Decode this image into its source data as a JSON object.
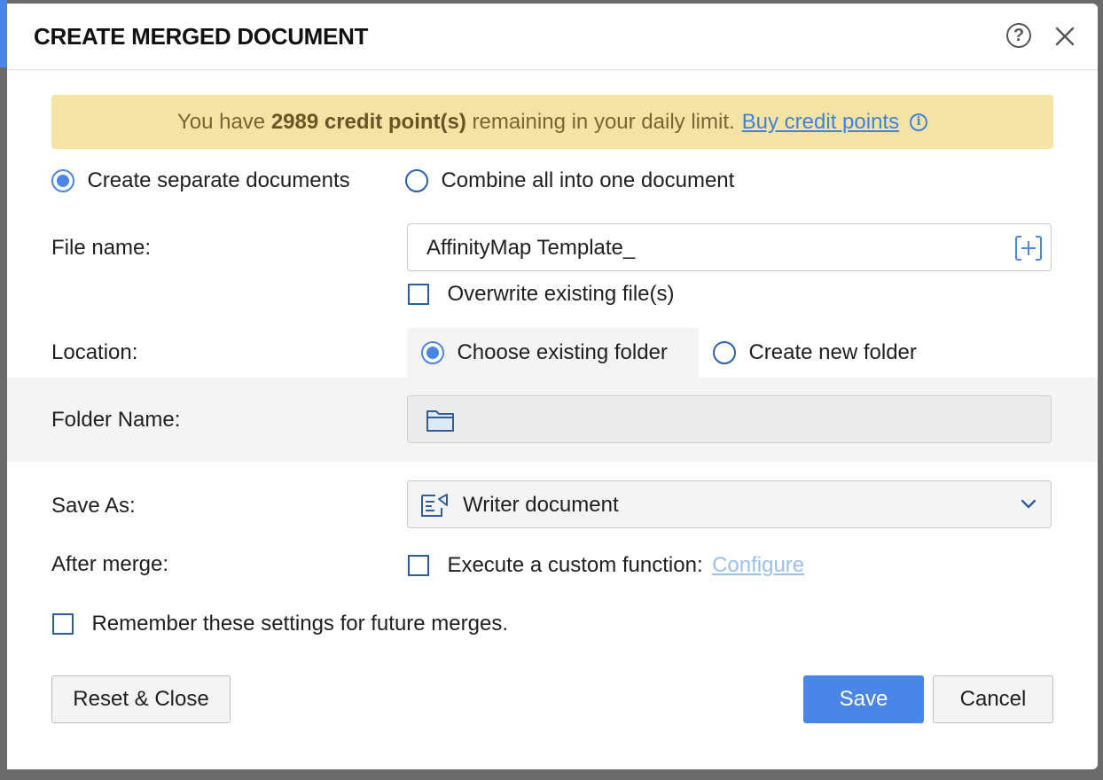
{
  "dialog": {
    "title": "CREATE MERGED DOCUMENT",
    "help_glyph": "?",
    "close_glyph": "×"
  },
  "banner": {
    "prefix": "You have",
    "credits": "2989 credit point(s)",
    "suffix": "remaining in your daily limit.",
    "link": "Buy credit points",
    "info_glyph": "i"
  },
  "output_mode": {
    "separate": "Create separate documents",
    "combine": "Combine all into one document",
    "selected": "separate"
  },
  "file_name": {
    "label": "File name:",
    "value": "AffinityMap Template_",
    "overwrite_label": "Overwrite existing file(s)",
    "overwrite_checked": false
  },
  "location": {
    "label": "Location:",
    "existing": "Choose existing folder",
    "new": "Create new folder",
    "selected": "existing"
  },
  "folder": {
    "label": "Folder Name:",
    "value": ""
  },
  "save_as": {
    "label": "Save As:",
    "value": "Writer document"
  },
  "after_merge": {
    "label": "After merge:",
    "option": "Execute a custom function:",
    "configure": "Configure",
    "checked": false
  },
  "remember": {
    "label": "Remember these settings for future merges.",
    "checked": false
  },
  "buttons": {
    "reset": "Reset & Close",
    "save": "Save",
    "cancel": "Cancel"
  },
  "colors": {
    "accent": "#4a86e8",
    "banner_bg": "#f5e3a6",
    "banner_text": "#7b6432",
    "link": "#3e82e0"
  },
  "icons": [
    "help-icon",
    "close-icon",
    "info-icon",
    "insert-field-icon",
    "folder-icon",
    "writer-doc-icon",
    "chevron-down-icon"
  ]
}
